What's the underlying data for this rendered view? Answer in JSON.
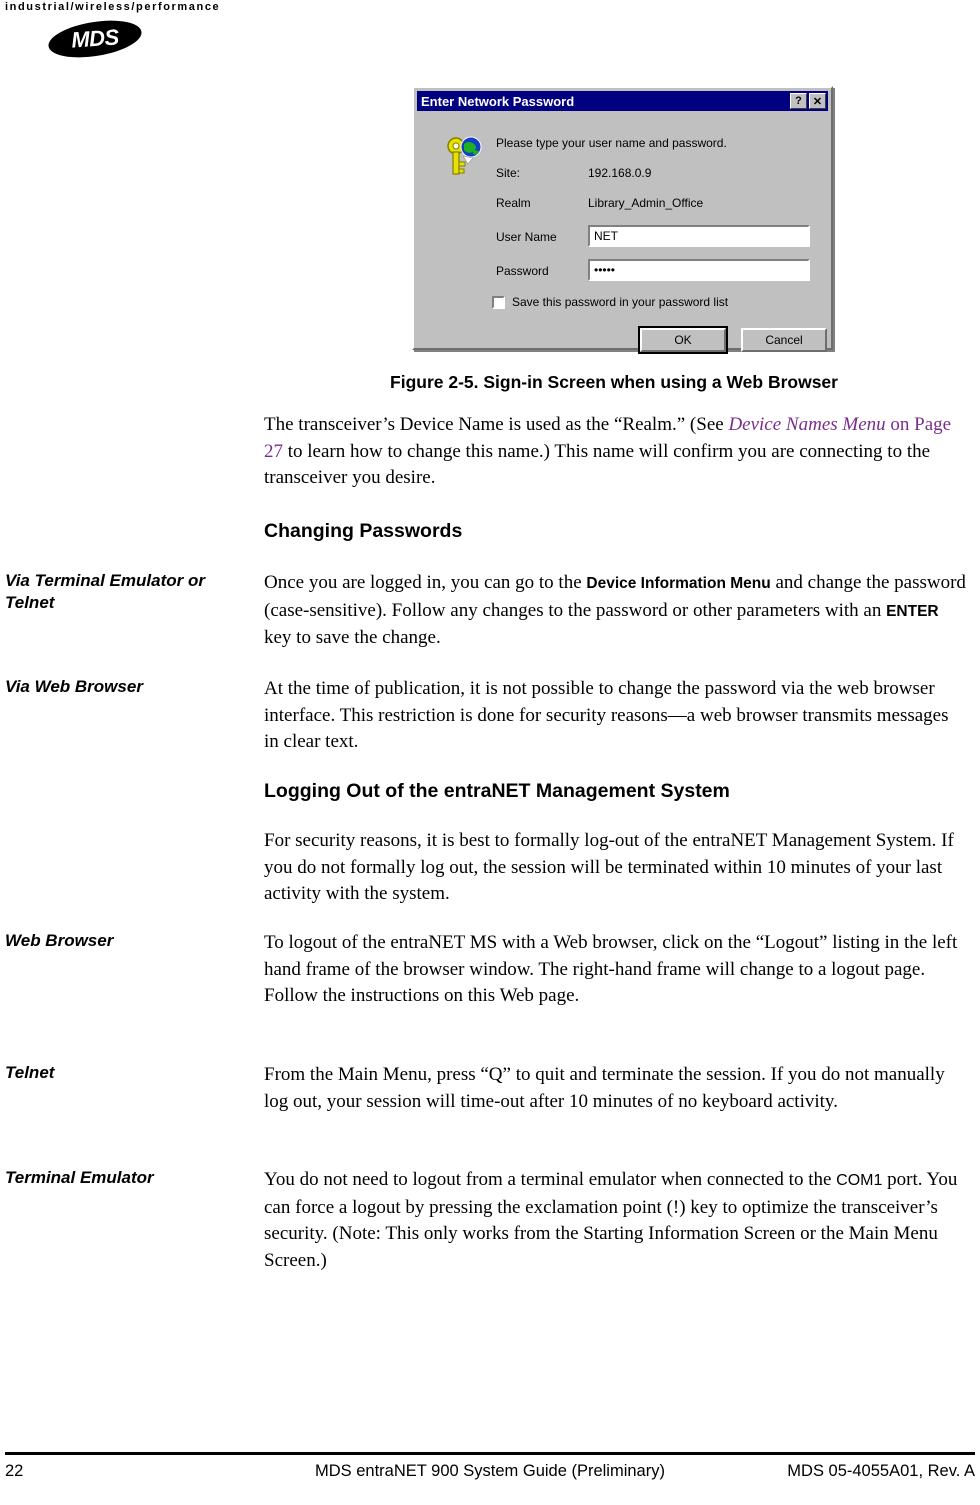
{
  "header": {
    "tagline": "industrial/wireless/performance",
    "logo_text": "MDS"
  },
  "dialog": {
    "title": "Enter Network Password",
    "help_button": "?",
    "close_button": "✕",
    "prompt": "Please type your user name and password.",
    "site_label": "Site:",
    "site_value": "192.168.0.9",
    "realm_label": "Realm",
    "realm_value": "Library_Admin_Office",
    "username_label": "User Name",
    "username_value": "NET",
    "password_label": "Password",
    "password_value": "•••••",
    "save_checkbox_label": "Save this password in your password list",
    "save_checkbox_checked": false,
    "ok_label": "OK",
    "cancel_label": "Cancel",
    "title_bar_color": "#000080",
    "face_color": "#c0c0c0"
  },
  "figure": {
    "caption": "Figure 2-5. Sign-in Screen when using a Web Browser"
  },
  "content": {
    "intro_p1": "The transceiver’s Device Name is used as the “Realm.” (See ",
    "intro_xref_italic": "Device Names Menu",
    "intro_xref_plain": " on Page 27",
    "intro_p2": " to learn how to change this name.) This name will confirm you are connecting to the transceiver you desire.",
    "heading_changing_passwords": "Changing Passwords",
    "side_via_terminal": "Via Terminal Emulator or Telnet",
    "via_terminal_p1": "Once you are logged in, you can go to the ",
    "via_terminal_ui1": "Device Information Menu",
    "via_terminal_p2": " and change the password (case-sensitive). Follow any changes to the password or other parameters with an ",
    "via_terminal_ui2": "ENTER",
    "via_terminal_p3": " key to save the change.",
    "side_via_web_browser": "Via Web Browser",
    "via_web_browser_body": "At the time of publication, it is not possible to change the password via the web browser interface. This restriction is done for security reasons—a web browser transmits messages in clear text.",
    "heading_logging_out": "Logging Out of the entraNET Management System",
    "logging_out_body": "For security reasons, it is best to formally log-out of the entraNET Management System. If you do not formally log out, the session will be terminated within 10 minutes of your last activity with the system.",
    "side_web_browser": "Web Browser",
    "web_browser_body": "To logout of the entraNET MS with a Web browser, click on the “Logout” listing in the left hand frame of the browser window. The right-hand frame will change to a logout page. Follow the instructions on this Web page.",
    "side_telnet": "Telnet",
    "telnet_body": "From the Main Menu, press “Q” to quit and terminate the session. If you do not manually log out, your session will time-out after 10 minutes of no keyboard activity.",
    "side_terminal_emulator": "Terminal Emulator",
    "terminal_emulator_p1": "You do not need to logout from a terminal emulator when connected to the ",
    "terminal_emulator_ui1": "COM1",
    "terminal_emulator_p2": " port. You can force a logout by pressing the exclamation point (!) key to optimize the transceiver’s security. (Note: This only works from the Starting Information Screen or the Main Menu Screen.)"
  },
  "footer": {
    "page_number": "22",
    "center": "MDS entraNET 900 System Guide (Preliminary)",
    "right": "MDS 05-4055A01, Rev. A"
  }
}
